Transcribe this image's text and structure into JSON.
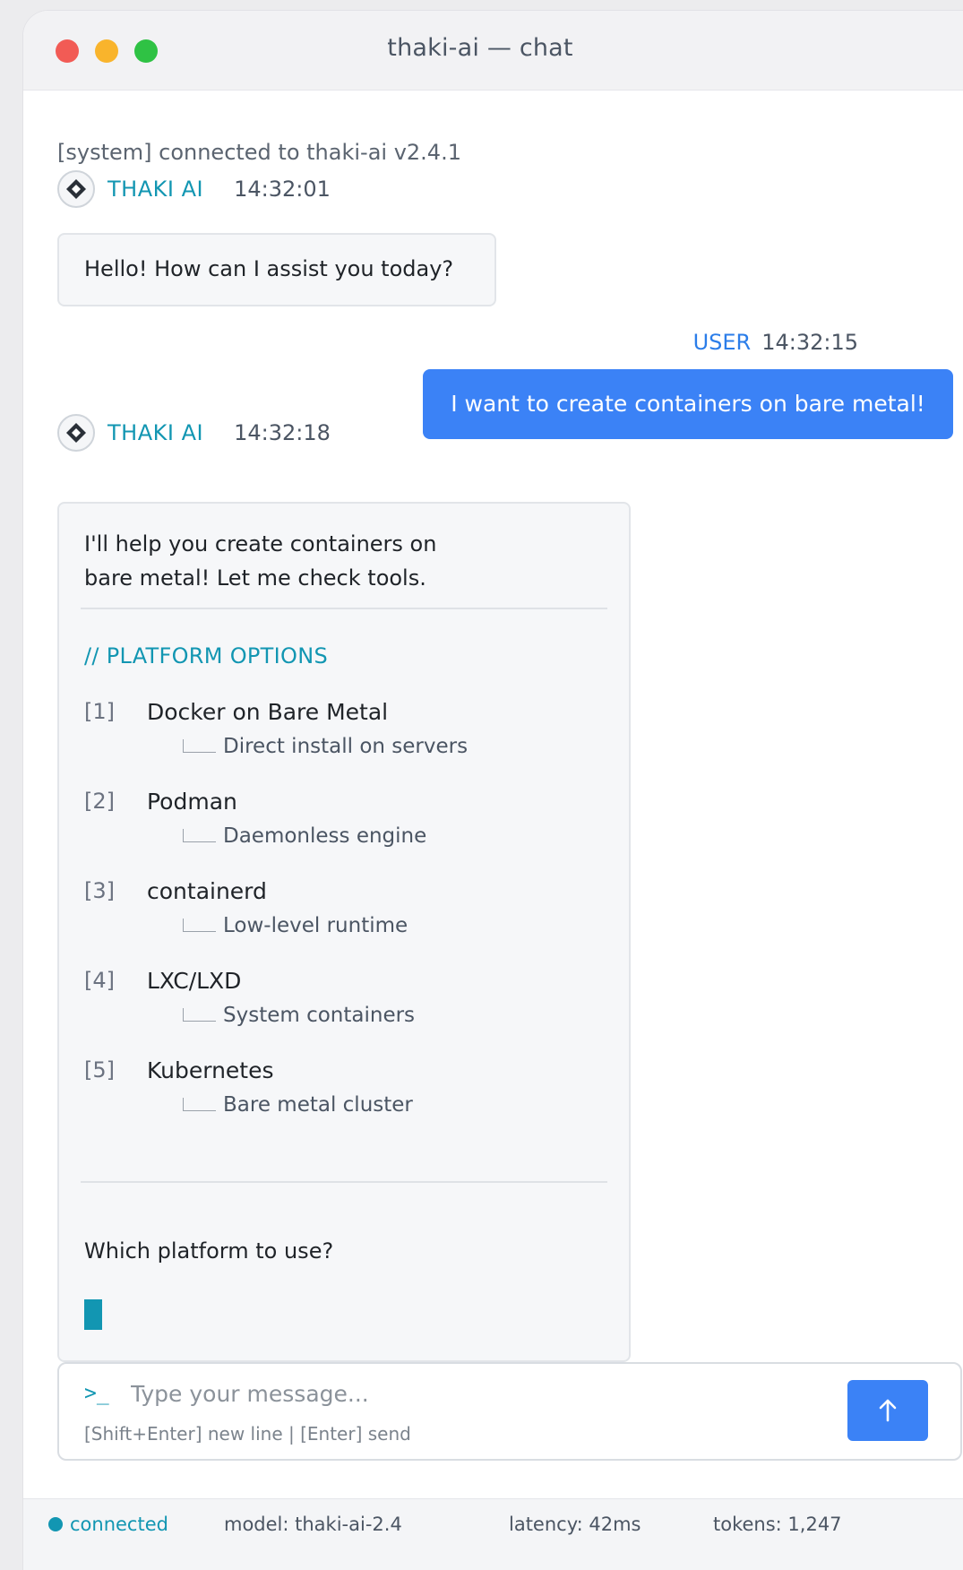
{
  "window": {
    "title": "thaki-ai — chat"
  },
  "system_message": "[system] connected to thaki-ai v2.4.1",
  "messages": [
    {
      "sender": "THAKI AI",
      "time": "14:32:01",
      "text": "Hello! How can I assist you today?"
    },
    {
      "sender": "USER",
      "time": "14:32:15",
      "text": "I want to create containers on bare metal!"
    },
    {
      "sender": "THAKI AI",
      "time": "14:32:18",
      "intro_line1": "I'll help you create containers on",
      "intro_line2": "bare metal! Let me check tools.",
      "options_title": "// PLATFORM OPTIONS",
      "options": [
        {
          "num": "[1]",
          "name": "Docker on Bare Metal",
          "desc": "Direct install on servers"
        },
        {
          "num": "[2]",
          "name": "Podman",
          "desc": "Daemonless engine"
        },
        {
          "num": "[3]",
          "name": "containerd",
          "desc": "Low-level runtime"
        },
        {
          "num": "[4]",
          "name": "LXC/LXD",
          "desc": "System containers"
        },
        {
          "num": "[5]",
          "name": "Kubernetes",
          "desc": "Bare metal cluster"
        }
      ],
      "question": "Which platform to use?"
    }
  ],
  "composer": {
    "prompt": ">_",
    "placeholder": "Type your message...",
    "value": "",
    "hint": "[Shift+Enter] new line | [Enter] send",
    "send_icon": "arrow-up-icon"
  },
  "status_bar": {
    "connection": "connected",
    "model": "model: thaki-ai-2.4",
    "latency": "latency: 42ms",
    "tokens": "tokens: 1,247"
  },
  "colors": {
    "accent_teal": "#1296b2",
    "user_blue": "#3b82f6",
    "traffic_red": "#f25b55",
    "traffic_yellow": "#f9b42c",
    "traffic_green": "#2fc244"
  }
}
